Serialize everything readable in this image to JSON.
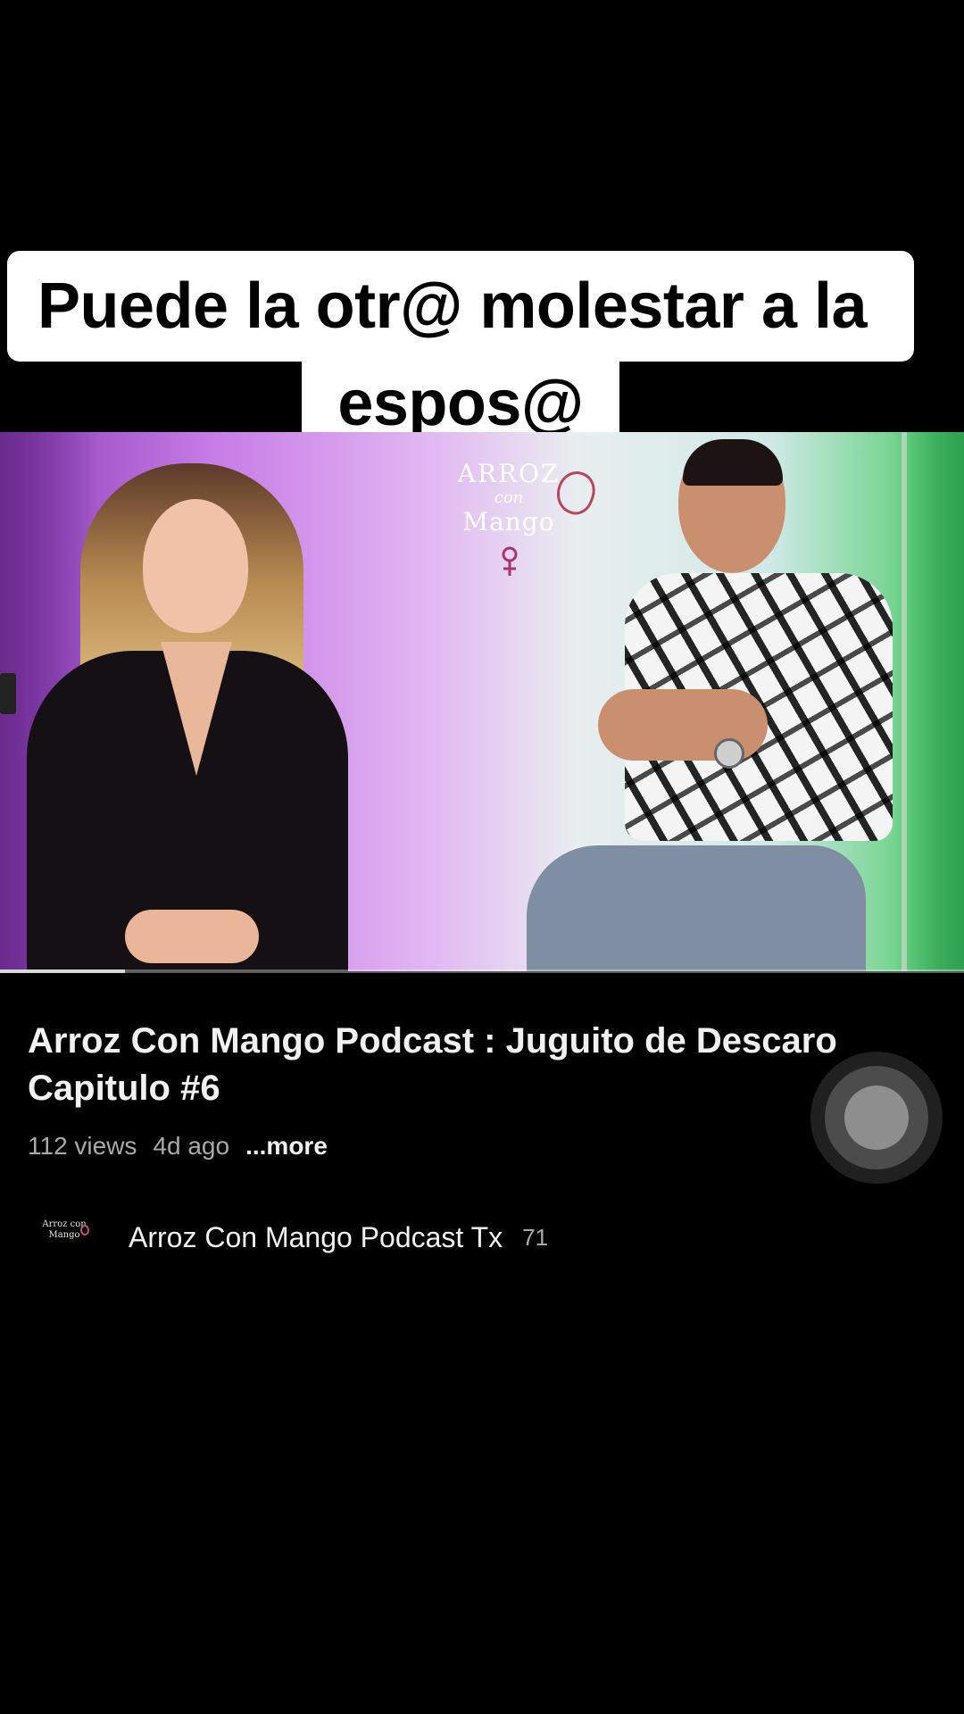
{
  "caption": {
    "line1": "Puede la otr@ molestar a la",
    "line2": "espos@"
  },
  "video": {
    "logo": {
      "line1": "ARROZ",
      "line2": "con",
      "line3": "Mango"
    },
    "progress_fraction": 0.13
  },
  "info": {
    "title": "Arroz Con Mango Podcast : Juguito de Descaro Capitulo #6",
    "views": "112 views",
    "age": "4d ago",
    "more_label": "...more"
  },
  "channel": {
    "avatar_text": "Arroz con Mango",
    "name": "Arroz Con Mango Podcast Tx",
    "subscribers": "71"
  },
  "icons": {
    "assistive_touch": "assistive-touch-icon",
    "mango": "mango-icon",
    "female_symbol": "female-symbol-icon"
  },
  "colors": {
    "background": "#000000",
    "caption_bg": "#ffffff",
    "text_primary": "#f1f1f1",
    "text_secondary": "#aaaaaa",
    "logo_accent": "#b9475a"
  }
}
